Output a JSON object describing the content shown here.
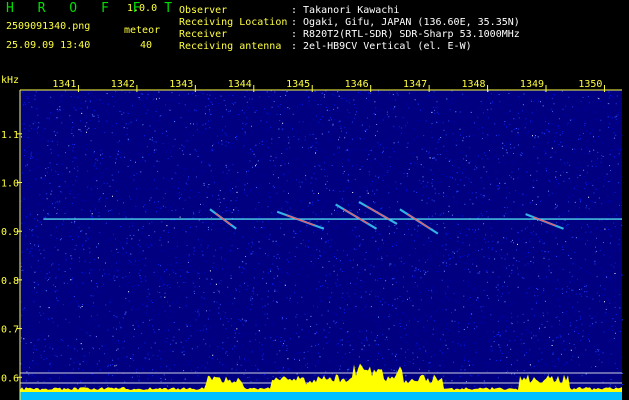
{
  "header": {
    "app_name": "H R O F F T",
    "version": "1.0.0",
    "filename": "2509091340.png",
    "datetime": "25.09.09 13:40",
    "meteor_label": "meteor",
    "meteor_count": "40",
    "info": [
      {
        "label": "Observer",
        "value": ": Takanori Kawachi"
      },
      {
        "label": "Receiving Location",
        "value": ": Ogaki, Gifu, JAPAN (136.60E, 35.35N)"
      },
      {
        "label": "Receiver",
        "value": ": R820T2(RTL-SDR) SDR-Sharp 53.1000MHz"
      },
      {
        "label": "Receiving antenna",
        "value": ": 2el-HB9CV Vertical (el. E-W)"
      }
    ]
  },
  "chart_data": {
    "type": "heatmap",
    "ylabel": "kHz",
    "x_ticks": [
      "1341",
      "1342",
      "1343",
      "1344",
      "1345",
      "1346",
      "1347",
      "1348",
      "1349",
      "1350"
    ],
    "y_ticks": [
      "1.1",
      "1.0",
      "0.9",
      "0.8",
      "0.7",
      "0.6"
    ],
    "ylim": [
      0.58,
      1.19
    ],
    "carrier_khz": 0.925,
    "meteor_traces": [
      {
        "t0": 1343.25,
        "f0": 0.945,
        "t1": 1343.7,
        "f1": 0.905
      },
      {
        "t0": 1344.4,
        "f0": 0.94,
        "t1": 1345.2,
        "f1": 0.905
      },
      {
        "t0": 1345.4,
        "f0": 0.955,
        "t1": 1346.1,
        "f1": 0.905
      },
      {
        "t0": 1345.8,
        "f0": 0.96,
        "t1": 1346.45,
        "f1": 0.915
      },
      {
        "t0": 1346.5,
        "f0": 0.945,
        "t1": 1347.15,
        "f1": 0.895
      },
      {
        "t0": 1348.65,
        "f0": 0.935,
        "t1": 1349.3,
        "f1": 0.905
      }
    ],
    "colors": {
      "background": "#000080",
      "axis_text": "#ffff40",
      "carrier": "#60ffff",
      "meteor": "#ff5060",
      "power_fill": "#ffff00",
      "power_base": "#00c0ff"
    }
  }
}
